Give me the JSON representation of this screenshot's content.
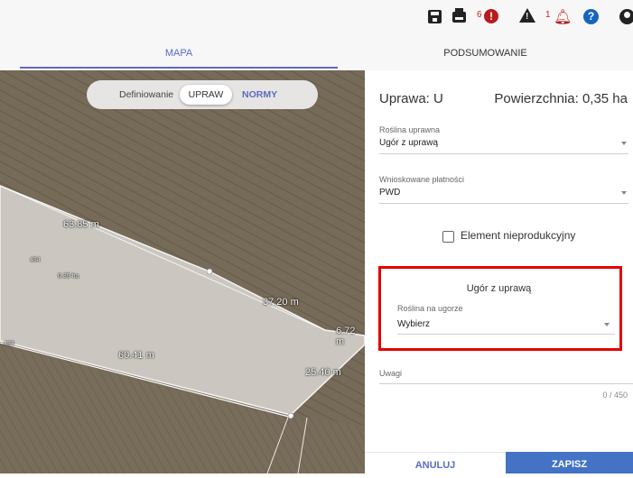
{
  "toolbar": {
    "error_count": "6",
    "warning_count": "1",
    "icons": [
      "save-icon",
      "print-icon",
      "error-icon",
      "warning-icon",
      "bell-icon",
      "help-icon",
      "account-icon"
    ],
    "colors": {
      "error": "#b71c1c",
      "help": "#1565c0"
    }
  },
  "tabs": [
    {
      "label": "MAPA",
      "active": true
    },
    {
      "label": "PODSUMOWANIE",
      "active": false
    }
  ],
  "map": {
    "mode_label": "Definiowanie",
    "mode_options": [
      {
        "label": "UPRAW",
        "selected": true
      },
      {
        "label": "NORMY",
        "selected": false
      }
    ],
    "labels": {
      "edge_top": "63.85 m",
      "parcel_id": "434",
      "parcel_area": "0.35 ha",
      "edge_right": "37.20 m",
      "edge_far": "6.72 m",
      "parcel_left": "433",
      "edge_bottom": "60.41 m",
      "edge_right_bottom": "25.40 m"
    }
  },
  "panel": {
    "title": "Uprawa: U",
    "area": "Powierzchnia: 0,35 ha",
    "fields": {
      "roslina_label": "Roślina uprawna",
      "roslina_value": "Ugór z uprawą",
      "platnosci_label": "Wnioskowane płatności",
      "platnosci_value": "PWD",
      "nieprod_label": "Element nieprodukcyjny",
      "ugor_title": "Ugór z uprawą",
      "na_ugorze_label": "Roślina na ugorze",
      "na_ugorze_value": "Wybierz",
      "uwagi_label": "Uwagi",
      "uwagi_counter": "0 / 450"
    },
    "buttons": {
      "cancel": "ANULUJ",
      "save": "ZAPISZ"
    },
    "colors": {
      "accent": "#5c6bc0",
      "save_button": "#4472c4",
      "highlight": "#e50000"
    }
  }
}
